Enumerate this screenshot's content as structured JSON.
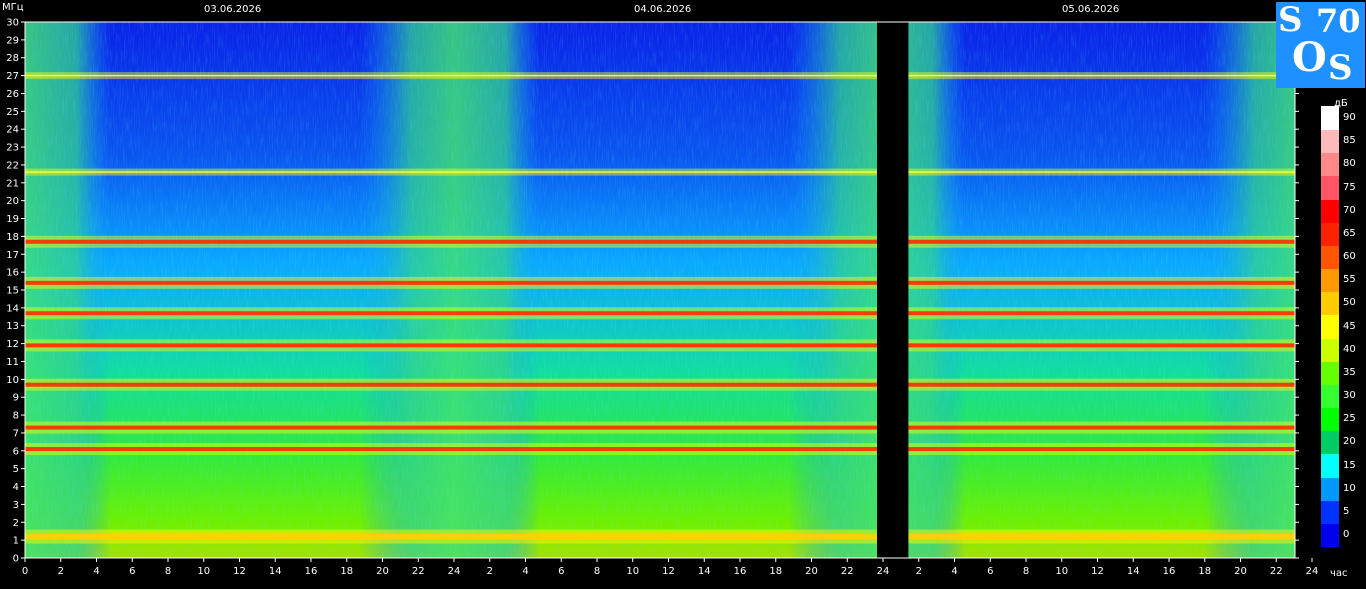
{
  "chart_data": {
    "type": "heatmap",
    "title": "",
    "ylabel": "МГц",
    "xlabel": "час",
    "ylim": [
      0,
      30
    ],
    "yticks": [
      0,
      1,
      2,
      3,
      4,
      5,
      6,
      7,
      8,
      9,
      10,
      11,
      12,
      13,
      14,
      15,
      16,
      17,
      18,
      19,
      20,
      21,
      22,
      23,
      24,
      25,
      26,
      27,
      28,
      29,
      30
    ],
    "dates": [
      "03.06.2026",
      "04.06.2026",
      "05.06.2026"
    ],
    "day_tick_labels": [
      [
        "0",
        "2",
        "4",
        "6",
        "8",
        "10",
        "12",
        "14",
        "16",
        "18",
        "20",
        "22",
        "24"
      ],
      [
        "2",
        "4",
        "6",
        "8",
        "10",
        "12",
        "14",
        "16",
        "18",
        "20",
        "22",
        "24"
      ],
      [
        "2",
        "4",
        "6",
        "8",
        "10",
        "12",
        "14",
        "16",
        "18",
        "20",
        "22",
        "24"
      ]
    ],
    "hours_shown_per_day": [
      24,
      24,
      23
    ],
    "data_gap_hours": [
      [
        0.0,
        0.75
      ]
    ],
    "gap_day_index": 2,
    "colorbar": {
      "unit": "дБ",
      "ticks": [
        0,
        5,
        10,
        15,
        20,
        25,
        30,
        35,
        40,
        45,
        50,
        55,
        60,
        65,
        70,
        75,
        80,
        85,
        90
      ],
      "colors": [
        "#0000ee",
        "#0033ff",
        "#0099ff",
        "#00ffff",
        "#00cc66",
        "#00ff00",
        "#33ff33",
        "#66ff00",
        "#ccff00",
        "#ffff00",
        "#ffcc00",
        "#ff9900",
        "#ff5500",
        "#ff2200",
        "#ff0000",
        "#ff5566",
        "#ff8888",
        "#ffbbbb",
        "#ffffff"
      ]
    },
    "bands_mhz": [
      {
        "f": 9.7,
        "level": "high"
      },
      {
        "f": 11.9,
        "level": "high"
      },
      {
        "f": 7.3,
        "level": "high"
      },
      {
        "f": 6.1,
        "level": "high"
      },
      {
        "f": 13.7,
        "level": "high"
      },
      {
        "f": 15.4,
        "level": "high"
      },
      {
        "f": 17.7,
        "level": "high"
      },
      {
        "f": 1.2,
        "level": "medium"
      },
      {
        "f": 21.6,
        "level": "low"
      },
      {
        "f": 27.0,
        "level": "low"
      }
    ]
  },
  "logo": {
    "text": [
      "S",
      "70",
      "O",
      "S"
    ]
  }
}
